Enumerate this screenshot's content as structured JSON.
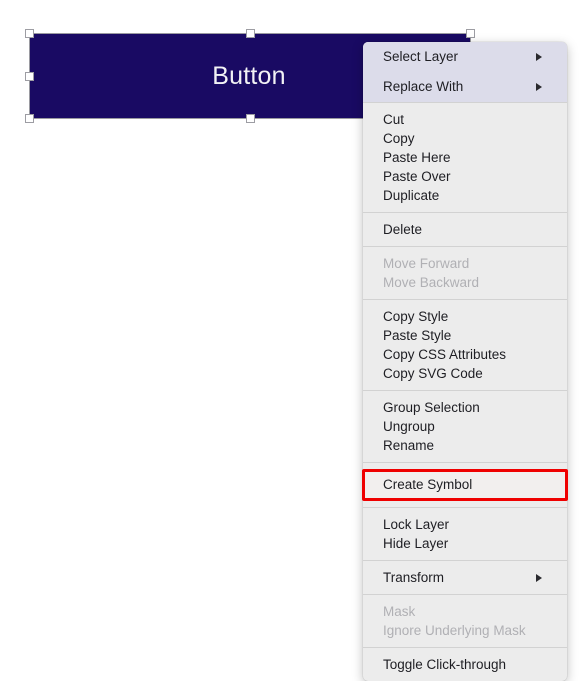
{
  "canvas": {
    "background_color": "#ffffff"
  },
  "shape": {
    "name": "Button",
    "label": "Button",
    "fill_color": "#190a63",
    "text_color": "#f2f2f5",
    "selected": true,
    "handles": [
      "top-left",
      "top-center",
      "top-right",
      "middle-left",
      "middle-right",
      "bottom-left",
      "bottom-center",
      "bottom-right"
    ]
  },
  "context_menu": {
    "highlight_color": "#ef0000",
    "highlighted_item": "Create Symbol",
    "sections": [
      {
        "items": [
          {
            "label": "Select Layer",
            "submenu": true,
            "disabled": false,
            "tall": true,
            "head": true
          },
          {
            "label": "Replace With",
            "submenu": true,
            "disabled": false,
            "tall": true,
            "head": true
          }
        ]
      },
      {
        "items": [
          {
            "label": "Cut",
            "submenu": false,
            "disabled": false
          },
          {
            "label": "Copy",
            "submenu": false,
            "disabled": false
          },
          {
            "label": "Paste Here",
            "submenu": false,
            "disabled": false
          },
          {
            "label": "Paste Over",
            "submenu": false,
            "disabled": false
          },
          {
            "label": "Duplicate",
            "submenu": false,
            "disabled": false
          }
        ]
      },
      {
        "items": [
          {
            "label": "Delete",
            "submenu": false,
            "disabled": false
          }
        ]
      },
      {
        "items": [
          {
            "label": "Move Forward",
            "submenu": false,
            "disabled": true
          },
          {
            "label": "Move Backward",
            "submenu": false,
            "disabled": true
          }
        ]
      },
      {
        "items": [
          {
            "label": "Copy Style",
            "submenu": false,
            "disabled": false
          },
          {
            "label": "Paste Style",
            "submenu": false,
            "disabled": false
          },
          {
            "label": "Copy CSS Attributes",
            "submenu": false,
            "disabled": false
          },
          {
            "label": "Copy SVG Code",
            "submenu": false,
            "disabled": false
          }
        ]
      },
      {
        "items": [
          {
            "label": "Group Selection",
            "submenu": false,
            "disabled": false
          },
          {
            "label": "Ungroup",
            "submenu": false,
            "disabled": false
          },
          {
            "label": "Rename",
            "submenu": false,
            "disabled": false
          }
        ]
      },
      {
        "items": [
          {
            "label": "Create Symbol",
            "submenu": false,
            "disabled": false,
            "highlighted": true
          }
        ]
      },
      {
        "items": [
          {
            "label": "Lock Layer",
            "submenu": false,
            "disabled": false
          },
          {
            "label": "Hide Layer",
            "submenu": false,
            "disabled": false
          }
        ]
      },
      {
        "items": [
          {
            "label": "Transform",
            "submenu": true,
            "disabled": false
          }
        ]
      },
      {
        "items": [
          {
            "label": "Mask",
            "submenu": false,
            "disabled": true
          },
          {
            "label": "Ignore Underlying Mask",
            "submenu": false,
            "disabled": true
          }
        ]
      },
      {
        "items": [
          {
            "label": "Toggle Click-through",
            "submenu": false,
            "disabled": false
          }
        ]
      }
    ]
  }
}
